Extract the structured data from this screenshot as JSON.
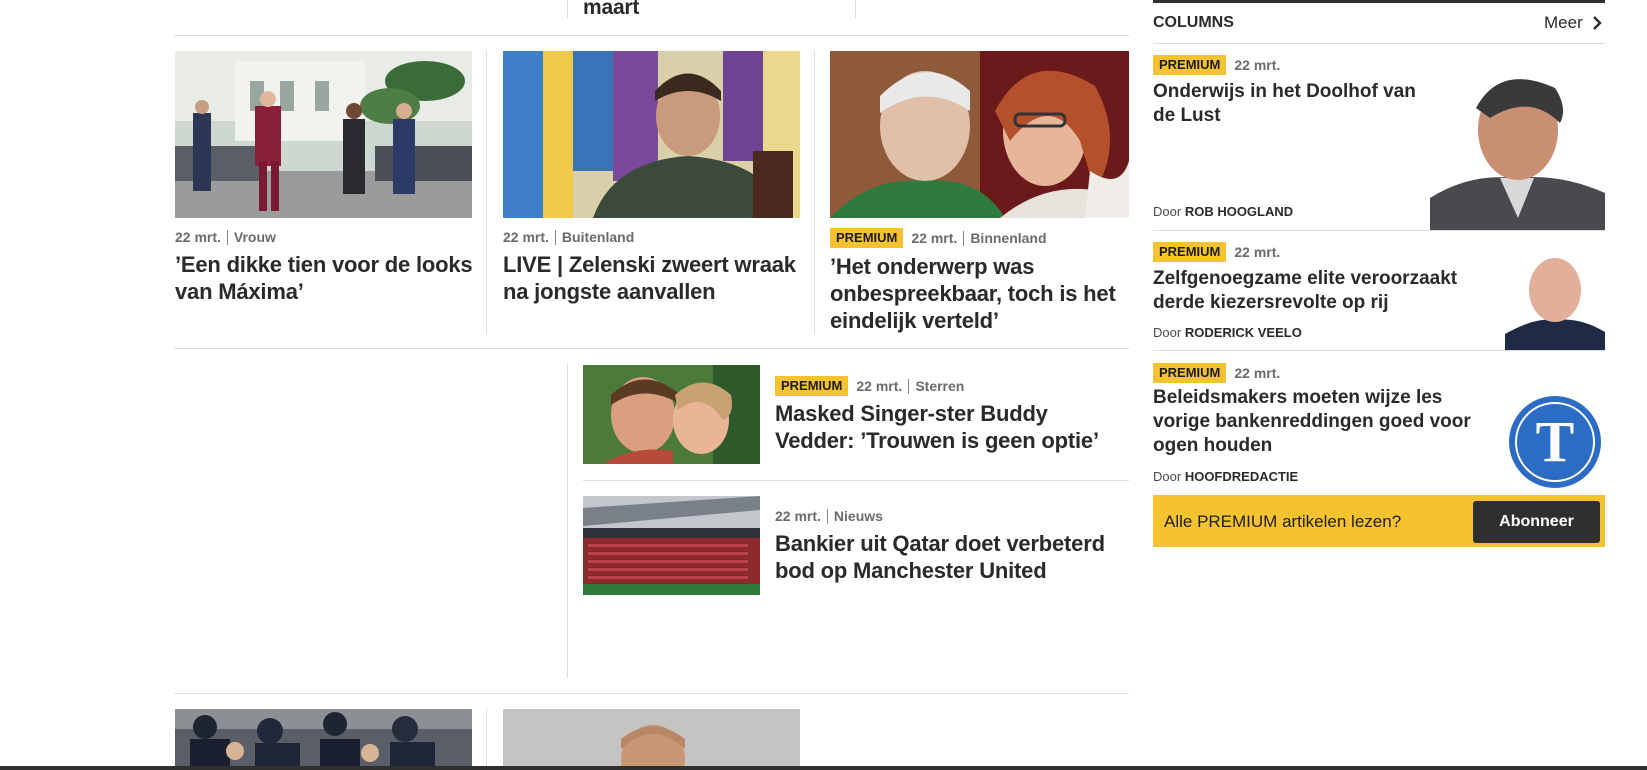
{
  "top_partial": {
    "headline_fragment": "maart"
  },
  "main": {
    "row1": [
      {
        "date": "22 mrt.",
        "category": "Vrouw",
        "headline": "’Een dikke tien voor de looks van Máxima’"
      },
      {
        "date": "22 mrt.",
        "category": "Buitenland",
        "headline": "LIVE | Zelenski zweert wraak na jongste aanvallen"
      },
      {
        "badge": "PREMIUM",
        "date": "22 mrt.",
        "category": "Binnenland",
        "headline": "’Het onderwerp was onbespreekbaar, toch is het eindelijk verteld’"
      }
    ],
    "row2": [
      {
        "badge": "PREMIUM",
        "date": "22 mrt.",
        "category": "Sterren",
        "headline": "Masked Singer-ster Buddy Vedder: ’Trouwen is geen optie’"
      },
      {
        "date": "22 mrt.",
        "category": "Nieuws",
        "headline": "Bankier uit Qatar doet verbeterd bod op Manchester United"
      }
    ]
  },
  "columns": {
    "title": "COLUMNS",
    "more_label": "Meer",
    "items": [
      {
        "badge": "PREMIUM",
        "date": "22 mrt.",
        "headline": "Onderwijs in het Doolhof van de Lust",
        "author_prefix": "Door",
        "author": "ROB HOOGLAND"
      },
      {
        "badge": "PREMIUM",
        "date": "22 mrt.",
        "headline": "Zelfgenoegzame elite veroorzaakt derde kiezersrevolte op rij",
        "author_prefix": "Door",
        "author": "RODERICK VEELO"
      },
      {
        "badge": "PREMIUM",
        "date": "22 mrt.",
        "headline": "Beleidsmakers moeten wijze les vorige bankenreddingen goed voor ogen houden",
        "author_prefix": "Door",
        "author": "HOOFDREDACTIE"
      }
    ],
    "logo_letter": "T",
    "cta": {
      "text": "Alle PREMIUM artikelen lezen?",
      "button": "Abonneer"
    }
  },
  "colors": {
    "premium": "#f5c330",
    "text": "#2a2a2a",
    "meta": "#6b6b6b",
    "divider": "#dedede",
    "logo_blue": "#2d6cc4",
    "button": "#2f2f2f"
  },
  "icons": {
    "more": "chevron-right-icon"
  }
}
